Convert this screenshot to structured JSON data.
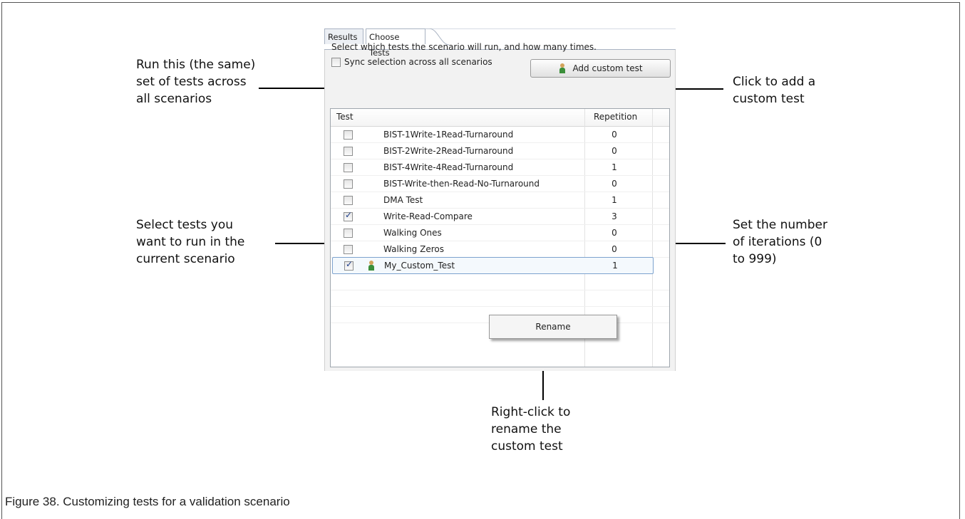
{
  "tabs": [
    {
      "label": "Results"
    },
    {
      "label": "Choose Tests"
    }
  ],
  "instructions": "Select which tests the scenario will run, and how many times.",
  "sync_label": "Sync selection across all scenarios",
  "sync_checked": false,
  "add_button_label": "Add custom test",
  "table": {
    "headers": [
      "Test",
      "Repetition"
    ],
    "rows": [
      {
        "name": "BIST-1Write-1Read-Turnaround",
        "repetition": "0",
        "checked": false
      },
      {
        "name": "BIST-2Write-2Read-Turnaround",
        "repetition": "0",
        "checked": false
      },
      {
        "name": "BIST-4Write-4Read-Turnaround",
        "repetition": "1",
        "checked": false
      },
      {
        "name": "BIST-Write-then-Read-No-Turnaround",
        "repetition": "0",
        "checked": false
      },
      {
        "name": "DMA Test",
        "repetition": "1",
        "checked": false
      },
      {
        "name": "Write-Read-Compare",
        "repetition": "3",
        "checked": true
      },
      {
        "name": "Walking Ones",
        "repetition": "0",
        "checked": false
      },
      {
        "name": "Walking Zeros",
        "repetition": "0",
        "checked": false
      },
      {
        "name": "My_Custom_Test",
        "repetition": "1",
        "checked": true,
        "custom": true,
        "selected": true
      }
    ]
  },
  "context_menu": {
    "items": [
      "Rename"
    ]
  },
  "callouts": {
    "sync": [
      "Run this (the same)",
      "set of tests across",
      "all scenarios"
    ],
    "add": [
      "Click to add a",
      "custom test"
    ],
    "select": [
      "Select tests you",
      "want to run in the",
      "current scenario"
    ],
    "iterations": [
      "Set the number",
      "of iterations (0",
      "to 999)"
    ],
    "rename": [
      "Right-click to",
      "rename the",
      "custom test"
    ]
  },
  "caption": "Figure 38.  Customizing tests for a validation scenario"
}
